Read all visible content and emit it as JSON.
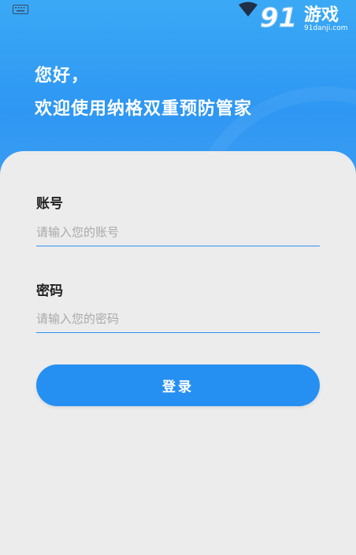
{
  "status_bar": {
    "keyboard_icon": "keyboard-icon",
    "signal_icon": "wifi-icon"
  },
  "watermark": {
    "logo": "91",
    "brand": "游戏",
    "domain": "91danji.com"
  },
  "header": {
    "greeting": "您好，",
    "welcome": "欢迎使用纳格双重预防管家"
  },
  "form": {
    "account_label": "账号",
    "account_placeholder": "请输入您的账号",
    "password_label": "密码",
    "password_placeholder": "请输入您的密码",
    "login_label": "登录"
  },
  "colors": {
    "header_blue": "#3aa9f5",
    "accent": "#2690f2",
    "background": "#ececec"
  }
}
